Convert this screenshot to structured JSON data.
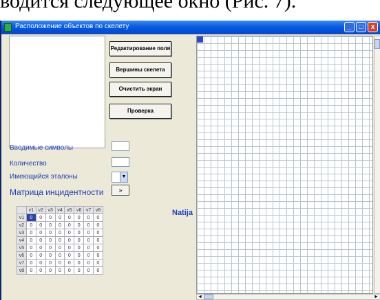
{
  "caption": "водится следующее окно (Рис. 7).",
  "window": {
    "title": "Расположение объектов по скелету",
    "minimize_glyph": "_",
    "maximize_glyph": "□",
    "close_glyph": "x"
  },
  "buttons": {
    "edit_field": "Редактирование поля",
    "skeleton_vertices": "Вершины скелета",
    "clear_screen": "Очистить экран",
    "check": "Проверка"
  },
  "labels": {
    "input_symbols": "Вводимые символы",
    "quantity": "Количество",
    "existing_templates": "Имеющийся эталоны",
    "incidence_matrix": "Матрица инцидентности",
    "footer": "Natija"
  },
  "combo_arrow": "▼",
  "small_button": "»",
  "matrix": {
    "headers": [
      "",
      "v1",
      "v2",
      "v3",
      "v4",
      "v5",
      "v6",
      "v7",
      "v8"
    ],
    "rows": [
      [
        "v1",
        "0",
        "0",
        "0",
        "0",
        "0",
        "0",
        "0",
        "0"
      ],
      [
        "v2",
        "0",
        "0",
        "0",
        "0",
        "0",
        "0",
        "0",
        "0"
      ],
      [
        "v3",
        "0",
        "0",
        "0",
        "0",
        "0",
        "0",
        "0",
        "0"
      ],
      [
        "v4",
        "0",
        "0",
        "0",
        "0",
        "0",
        "0",
        "0",
        "0"
      ],
      [
        "v5",
        "0",
        "0",
        "0",
        "0",
        "0",
        "0",
        "0",
        "0"
      ],
      [
        "v6",
        "0",
        "0",
        "0",
        "0",
        "0",
        "0",
        "0",
        "0"
      ],
      [
        "v7",
        "0",
        "0",
        "0",
        "0",
        "0",
        "0",
        "0",
        "0"
      ],
      [
        "v8",
        "0",
        "0",
        "0",
        "0",
        "0",
        "0",
        "0",
        "0"
      ]
    ]
  },
  "scroll": {
    "left": "◄",
    "right": "►"
  },
  "colors": {
    "title_bar": "#0a5fe2",
    "label_blue": "#1c3fb8",
    "selected_cell": "#2a45a8",
    "grid_line": "#b8c4cc"
  }
}
